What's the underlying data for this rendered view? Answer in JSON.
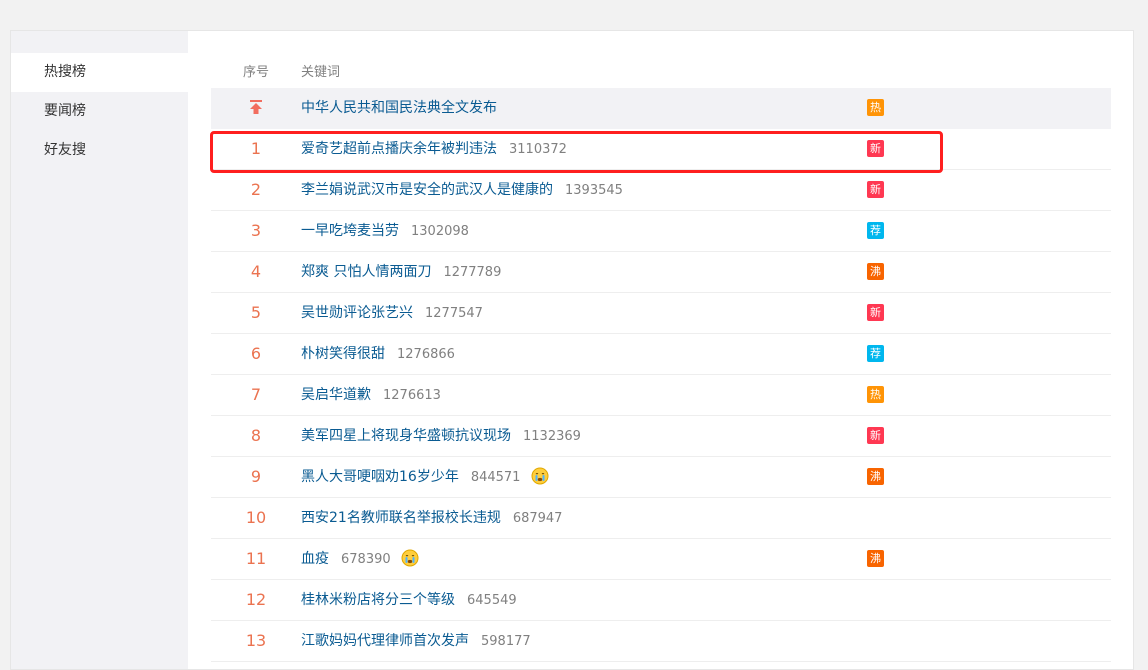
{
  "sidebar": {
    "items": [
      {
        "label": "热搜榜",
        "active": true
      },
      {
        "label": "要闻榜",
        "active": false
      },
      {
        "label": "好友搜",
        "active": false
      }
    ]
  },
  "table": {
    "headers": {
      "rank": "序号",
      "keyword": "关键词"
    },
    "pinned": {
      "keyword": "中华人民共和国民法典全文发布",
      "tag": "热",
      "tag_color": "#ff9406"
    },
    "rows": [
      {
        "rank": "1",
        "keyword": "爱奇艺超前点播庆余年被判违法",
        "count": "3110372",
        "tag": "新",
        "tag_color": "#ff3852",
        "emoji": false
      },
      {
        "rank": "2",
        "keyword": "李兰娟说武汉市是安全的武汉人是健康的",
        "count": "1393545",
        "tag": "新",
        "tag_color": "#ff3852",
        "emoji": false
      },
      {
        "rank": "3",
        "keyword": "一早吃垮麦当劳",
        "count": "1302098",
        "tag": "荐",
        "tag_color": "#00b7ee",
        "emoji": false
      },
      {
        "rank": "4",
        "keyword": "郑爽 只怕人情两面刀",
        "count": "1277789",
        "tag": "沸",
        "tag_color": "#f86400",
        "emoji": false
      },
      {
        "rank": "5",
        "keyword": "吴世勋评论张艺兴",
        "count": "1277547",
        "tag": "新",
        "tag_color": "#ff3852",
        "emoji": false
      },
      {
        "rank": "6",
        "keyword": "朴树笑得很甜",
        "count": "1276866",
        "tag": "荐",
        "tag_color": "#00b7ee",
        "emoji": false
      },
      {
        "rank": "7",
        "keyword": "吴启华道歉",
        "count": "1276613",
        "tag": "热",
        "tag_color": "#ff9406",
        "emoji": false
      },
      {
        "rank": "8",
        "keyword": "美军四星上将现身华盛顿抗议现场",
        "count": "1132369",
        "tag": "新",
        "tag_color": "#ff3852",
        "emoji": false
      },
      {
        "rank": "9",
        "keyword": "黑人大哥哽咽劝16岁少年",
        "count": "844571",
        "tag": "沸",
        "tag_color": "#f86400",
        "emoji": true
      },
      {
        "rank": "10",
        "keyword": "西安21名教师联名举报校长违规",
        "count": "687947",
        "tag": "",
        "tag_color": "",
        "emoji": false
      },
      {
        "rank": "11",
        "keyword": "血疫",
        "count": "678390",
        "tag": "沸",
        "tag_color": "#f86400",
        "emoji": true
      },
      {
        "rank": "12",
        "keyword": "桂林米粉店将分三个等级",
        "count": "645549",
        "tag": "",
        "tag_color": "",
        "emoji": false
      },
      {
        "rank": "13",
        "keyword": "江歌妈妈代理律师首次发声",
        "count": "598177",
        "tag": "",
        "tag_color": "",
        "emoji": false
      }
    ]
  },
  "colors": {
    "rank": "#eb7350",
    "link": "#0a5b92",
    "highlight": "#ff1f1f"
  },
  "icons": {
    "pinned": "pin-top-icon",
    "emoji": "crying-emoji-icon"
  }
}
